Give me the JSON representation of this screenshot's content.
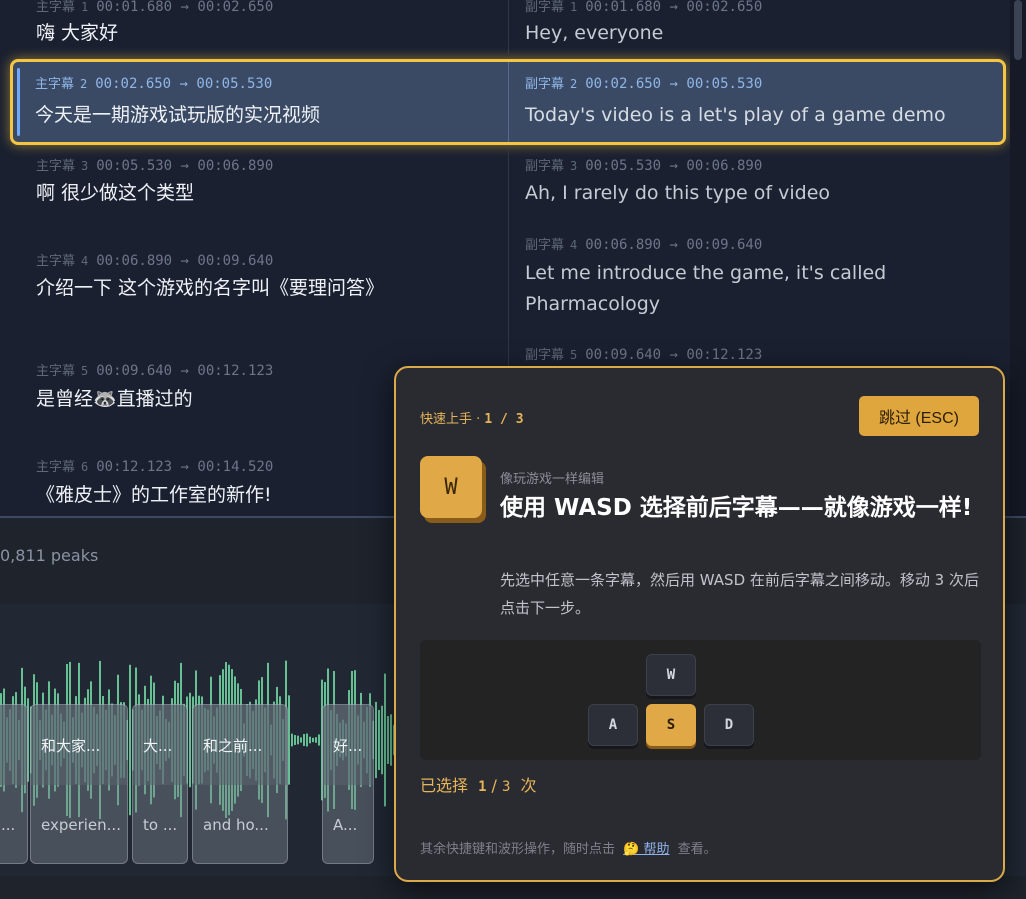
{
  "subtitles": {
    "primary_tag": "主字幕",
    "secondary_tag": "副字幕",
    "rows": [
      {
        "idx": "1",
        "tc": "00:01.680 → 00:02.650",
        "primary": "嗨  大家好",
        "secondary": "Hey, everyone"
      },
      {
        "idx": "2",
        "tc": "00:02.650 → 00:05.530",
        "primary": "今天是一期游戏试玩版的实况视频",
        "secondary": "Today's video is a let's play of a game demo"
      },
      {
        "idx": "3",
        "tc": "00:05.530 → 00:06.890",
        "primary": "啊  很少做这个类型",
        "secondary": "Ah, I rarely do this type of video"
      },
      {
        "idx": "4",
        "tc": "00:06.890 → 00:09.640",
        "primary": "介绍一下  这个游戏的名字叫《要理问答》",
        "secondary_lines": [
          "Let me introduce the game, it's called",
          "Pharmacology"
        ]
      },
      {
        "idx": "5",
        "tc": "00:09.640 → 00:12.123",
        "primary": "是曾经🦝直播过的",
        "secondary": ""
      },
      {
        "idx": "6",
        "tc": "00:12.123 → 00:14.520",
        "primary": "《雅皮士》的工作室的新作!",
        "secondary": ""
      }
    ]
  },
  "waveform": {
    "peaks_label": "0,811 peaks",
    "clips": [
      {
        "top": "",
        "bottom": "..."
      },
      {
        "top": "和大家...",
        "bottom": "experien..."
      },
      {
        "top": "大...",
        "bottom": "to ..."
      },
      {
        "top": "和之前...",
        "bottom": "and ho..."
      },
      {
        "top": "好...",
        "bottom": "A..."
      }
    ]
  },
  "tour": {
    "step_label": "快速上手 · ",
    "step_current": "1",
    "step_total": "3",
    "skip_label": "跳过 (ESC)",
    "badge_key": "W",
    "kicker": "像玩游戏一样编辑",
    "headline": "使用 WASD 选择前后字幕——就像游戏一样!",
    "description": "先选中任意一条字幕，然后用 WASD 在前后字幕之间移动。移动 3 次后点击下一步。",
    "keys": {
      "w": "W",
      "a": "A",
      "s": "S",
      "d": "D"
    },
    "active_key": "S",
    "progress_prefix": "已选择",
    "progress_done": "1",
    "progress_total": "3",
    "progress_suffix": "次",
    "footer_prefix": "其余快捷键和波形操作，随时点击",
    "help_link": "🤔 帮助",
    "footer_suffix": "查看。"
  },
  "colors": {
    "accent": "#e0a846",
    "highlight_border": "#f4c542",
    "waveform": "#6fcf9f",
    "active_row": "#3b4a64"
  }
}
